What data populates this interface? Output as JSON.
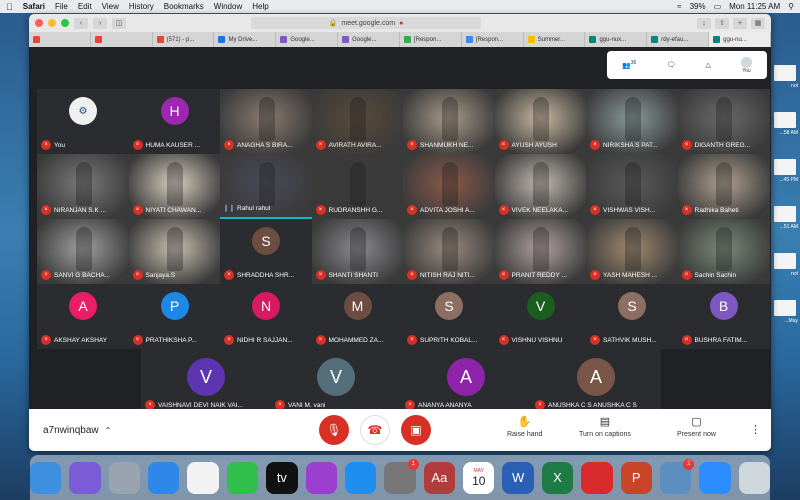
{
  "menubar": {
    "app": "Safari",
    "items": [
      "File",
      "Edit",
      "View",
      "History",
      "Bookmarks",
      "Window",
      "Help"
    ],
    "battery": "39%",
    "clock": "Mon 11:25 AM"
  },
  "desktop_files": [
    {
      "label": "not"
    },
    {
      "label": "...58 AM"
    },
    {
      "label": "...45 PM"
    },
    {
      "label": "...51 AM"
    },
    {
      "label": "not"
    },
    {
      "label": "...May"
    }
  ],
  "browser": {
    "url": "meet.google.com",
    "tabs": [
      {
        "label": "",
        "color": "#ea4335"
      },
      {
        "label": "",
        "color": "#ea4335"
      },
      {
        "label": "(571) - p...",
        "color": "#ea4335"
      },
      {
        "label": "My Drive...",
        "color": "#1a73e8"
      },
      {
        "label": "Google...",
        "color": "#7e57c2"
      },
      {
        "label": "Google...",
        "color": "#7e57c2"
      },
      {
        "label": "[Respon...",
        "color": "#34a853"
      },
      {
        "label": "[Respon...",
        "color": "#4285f4"
      },
      {
        "label": "Summer...",
        "color": "#fbbc05"
      },
      {
        "label": "ggu-nux...",
        "color": "#00897b"
      },
      {
        "label": "rdy-efau...",
        "color": "#00897b"
      },
      {
        "label": "ggu-nu...",
        "color": "#00897b"
      }
    ]
  },
  "meet": {
    "top_bar": {
      "participants_count": "36",
      "you_label": "You"
    },
    "meeting_code": "a7nwinqbaw",
    "controls": {
      "raise_hand": "Raise hand",
      "captions": "Turn on captions",
      "present": "Present now"
    },
    "colors": {
      "mic_off": "#d93025",
      "end_call": "#d93025",
      "speaking": "#00bcd4"
    },
    "rows": [
      [
        {
          "name": "You",
          "type": "logo"
        },
        {
          "name": "HUMA KAUSER ...",
          "type": "avatar",
          "initial": "H",
          "color": "#9c27b0"
        },
        {
          "name": "ANAGHA S BIRA...",
          "type": "video",
          "color": "#8a7a70"
        },
        {
          "name": "AVIRATH AVIRA...",
          "type": "video",
          "color": "#5a4a3a"
        },
        {
          "name": "SHANMUKH NE...",
          "type": "video",
          "color": "#a89a88"
        },
        {
          "name": "AYUSH AYUSH",
          "type": "video",
          "color": "#c8b8a0"
        },
        {
          "name": "NIRIKSHA S PAT...",
          "type": "video",
          "color": "#8a9a9a"
        },
        {
          "name": "DIGANTH GREG...",
          "type": "video",
          "color": "#6a6a6a"
        }
      ],
      [
        {
          "name": "NIRANJAN S.K ...",
          "type": "video",
          "color": "#7a7a7a"
        },
        {
          "name": "NIYATI CHAWAN...",
          "type": "video",
          "color": "#d8d0c0"
        },
        {
          "name": "Rahul rahul",
          "type": "video",
          "color": "#4a4a5a",
          "speaking": true
        },
        {
          "name": "RUDRANSHH G...",
          "type": "video",
          "color": "#3a3a3a"
        },
        {
          "name": "ADVITA JOSHI A...",
          "type": "video",
          "color": "#8a5a4a"
        },
        {
          "name": "VIVEK NEELAKA...",
          "type": "video",
          "color": "#c0b8b0"
        },
        {
          "name": "VISHWAS VISH...",
          "type": "video",
          "color": "#5a5a5a"
        },
        {
          "name": "Radhika Baheti",
          "type": "video",
          "color": "#b0a090"
        }
      ],
      [
        {
          "name": "SANVI G BACHA...",
          "type": "video",
          "color": "#a0a0a0"
        },
        {
          "name": "Sanjaya.S",
          "type": "video",
          "color": "#c8c0b0"
        },
        {
          "name": "SHRADDHA SHR...",
          "type": "avatar",
          "initial": "S",
          "color": "#6d4c41"
        },
        {
          "name": "SHANTI SHANTI",
          "type": "video",
          "color": "#8a8a90"
        },
        {
          "name": "NITISH RAJ NITI...",
          "type": "video",
          "color": "#9a8a80"
        },
        {
          "name": "PRANIT REDDY ...",
          "type": "video",
          "color": "#b0a0a0"
        },
        {
          "name": "YASH MAHESH ...",
          "type": "video",
          "color": "#a08a70"
        },
        {
          "name": "Sachin Sachin",
          "type": "video",
          "color": "#7a8a7a"
        }
      ],
      [
        {
          "name": "AKSHAY AKSHAY",
          "type": "avatar",
          "initial": "A",
          "color": "#e91e63"
        },
        {
          "name": "PRATHIKSHA P...",
          "type": "avatar",
          "initial": "P",
          "color": "#1e88e5"
        },
        {
          "name": "NIDHI R SAJJAN...",
          "type": "avatar",
          "initial": "N",
          "color": "#d81b60"
        },
        {
          "name": "MOHAMMED ZA...",
          "type": "avatar",
          "initial": "M",
          "color": "#6d4c41"
        },
        {
          "name": "SUPRITH KOBAL...",
          "type": "avatar",
          "initial": "S",
          "color": "#8d6e63"
        },
        {
          "name": "VISHNU VISHNU",
          "type": "avatar",
          "initial": "V",
          "color": "#1b5e20"
        },
        {
          "name": "SATHVIK MUSH...",
          "type": "avatar",
          "initial": "S",
          "color": "#8d6e63"
        },
        {
          "name": "BUSHRA FATIM...",
          "type": "avatar",
          "initial": "B",
          "color": "#7e57c2"
        }
      ],
      [
        {
          "name": "VAISHNAVI DEVI NAIK VAI...",
          "type": "avatar",
          "initial": "V",
          "color": "#5e35b1"
        },
        {
          "name": "VANI M. vani",
          "type": "avatar",
          "initial": "V",
          "color": "#546e7a"
        },
        {
          "name": "ANANYA ANANYA",
          "type": "avatar",
          "initial": "A",
          "color": "#8e24aa"
        },
        {
          "name": "ANUSHKA C S ANUSHKA C S",
          "type": "avatar",
          "initial": "A",
          "color": "#795548"
        }
      ]
    ]
  },
  "dock": [
    {
      "name": "finder",
      "color": "#3d8fe0"
    },
    {
      "name": "siri",
      "color": "#7a5cd6"
    },
    {
      "name": "launchpad",
      "color": "#9aa4b0"
    },
    {
      "name": "safari",
      "color": "#2f87e8"
    },
    {
      "name": "photos",
      "color": "#f2f2f2"
    },
    {
      "name": "facetime",
      "color": "#2fbf4a"
    },
    {
      "name": "apple-tv",
      "color": "#111111",
      "text": "tv"
    },
    {
      "name": "podcasts",
      "color": "#9b3fd0"
    },
    {
      "name": "app-store",
      "color": "#1f8ef1"
    },
    {
      "name": "system-preferences",
      "color": "#777777",
      "badge": "1"
    },
    {
      "name": "dictionary",
      "color": "#b23b3b",
      "text": "Aa"
    },
    {
      "name": "calendar",
      "color": "#ffffff",
      "text": "10",
      "month": "MAY"
    },
    {
      "name": "word",
      "color": "#2b5fb4",
      "text": "W"
    },
    {
      "name": "excel",
      "color": "#1e7b45",
      "text": "X"
    },
    {
      "name": "acrobat",
      "color": "#d92b2b"
    },
    {
      "name": "powerpoint",
      "color": "#c8452a",
      "text": "P"
    },
    {
      "name": "preview",
      "color": "#5a8fc0",
      "badge": "2"
    },
    {
      "name": "zoom",
      "color": "#2d8cff"
    },
    {
      "name": "trash",
      "color": "#cfd6dc"
    }
  ]
}
